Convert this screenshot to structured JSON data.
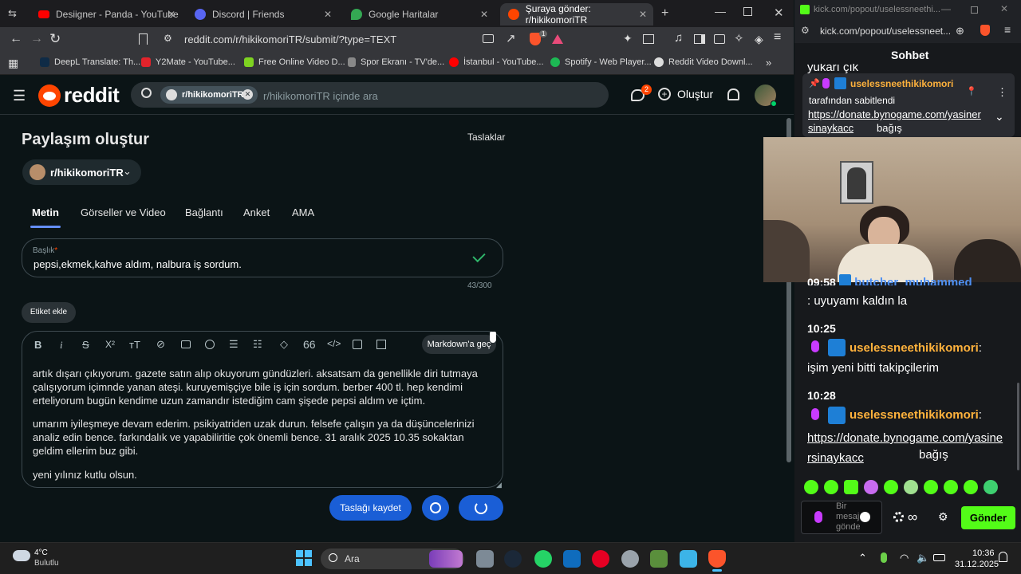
{
  "browser": {
    "tabs": [
      {
        "label": "Desiigner - Panda - YouTube"
      },
      {
        "label": "Discord | Friends"
      },
      {
        "label": "Google Haritalar"
      },
      {
        "label": "Şuraya gönder: r/hikikomoriTR"
      }
    ],
    "url": "reddit.com/r/hikikomoriTR/submit/?type=TEXT",
    "bookmarks": [
      "DeepL Translate: Th...",
      "Y2Mate - YouTube...",
      "Free Online Video D...",
      "Spor Ekranı - TV'de...",
      "İstanbul - YouTube...",
      "Spotify - Web Player...",
      "Reddit Video Downl..."
    ],
    "ext_badge": "1"
  },
  "reddit": {
    "logo_text": "reddit",
    "search_chip": "r/hikikomoriTR",
    "search_placeholder": "r/hikikomoriTR içinde ara",
    "chat_badge": "2",
    "create_label": "Oluştur",
    "page_title": "Paylaşım oluştur",
    "drafts_label": "Taslaklar",
    "community": "r/hikikomoriTR",
    "post_tabs": [
      "Metin",
      "Görseller ve Video",
      "Bağlantı",
      "Anket",
      "AMA"
    ],
    "title_label": "Başlık",
    "title_required": "*",
    "title_value": "pepsi,ekmek,kahve aldım, nalbura iş sordum.",
    "char_count": "43/300",
    "tag_button": "Etiket ekle",
    "markdown_button": "Markdown'a geç",
    "body_paragraphs": [
      "artık dışarı çıkıyorum. gazete satın alıp okuyorum gündüzleri. aksatsam da genellikle diri tutmaya çalışıyorum içimnde yanan ateşi. kuruyemişçiye bile iş için sordum. berber 400 tl. hep kendimi erteliyorum bugün kendime uzun zamandır istediğim cam şişede pepsi aldım ve içtim.",
      "umarım iyileşmeye devam ederim. psikiyatriden uzak durun. felsefe çalışın ya da düşüncelerinizi analiz edin bence. farkındalık ve yapabiliritie çok önemli bence. 31 aralık 2025 10.35 sokaktan geldim ellerim buz gibi.",
      "yeni yılınız kutlu olsun."
    ],
    "save_draft": "Taslağı kaydet"
  },
  "kick": {
    "window_title": "kick.com/popout/uselessneethi...",
    "url": "kick.com/popout/uselessneet...",
    "header": "Sohbet",
    "pinned_user": "uselessneethikikomori",
    "pinned_by": "tarafından sabitlendi",
    "pinned_link": "https://donate.bynogame.com/yasinersinaykacc",
    "pinned_suffix": "bağış",
    "cut_top": "yukarı çık",
    "messages": [
      {
        "time": "09:58",
        "user": "butcher_muhammed",
        "text": ": uyuyamı kaldın la"
      },
      {
        "time": "10:25",
        "user": "uselessneethikikomori",
        "text": ":",
        "body": "işim yeni bitti takipçilerim"
      },
      {
        "time": "10:28",
        "user": "uselessneethikikomori",
        "text": ":",
        "body": "https://donate.bynogame.com/yasinersinaykacc",
        "suffix": "bağış"
      }
    ],
    "input_placeholder": "Bir mesaj gönderin",
    "send_label": "Gönder",
    "infinity": "∞"
  },
  "taskbar": {
    "weather_temp": "4°C",
    "weather_desc": "Bulutlu",
    "search_label": "Ara",
    "time": "10:36",
    "date": "31.12.2025"
  },
  "colors": {
    "reddit_orange": "#ff4500",
    "reddit_blue": "#1a5ed6",
    "kick_green": "#53fc18",
    "kick_user": "#ffb23c"
  }
}
